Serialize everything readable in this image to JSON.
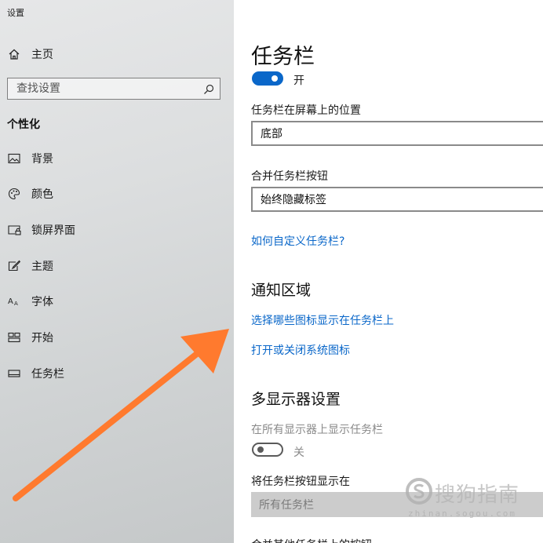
{
  "window": {
    "title": "设置"
  },
  "sidebar": {
    "home_label": "主页",
    "search_placeholder": "查找设置",
    "section_title": "个性化",
    "items": [
      {
        "label": "背景",
        "icon": "picture-icon"
      },
      {
        "label": "颜色",
        "icon": "palette-icon"
      },
      {
        "label": "锁屏界面",
        "icon": "lock-screen-icon"
      },
      {
        "label": "主题",
        "icon": "theme-icon"
      },
      {
        "label": "字体",
        "icon": "font-icon"
      },
      {
        "label": "开始",
        "icon": "start-icon"
      },
      {
        "label": "任务栏",
        "icon": "taskbar-icon"
      }
    ]
  },
  "main": {
    "title": "任务栏",
    "lock_toggle": {
      "state": "on",
      "label": "开"
    },
    "position": {
      "label": "任务栏在屏幕上的位置",
      "value": "底部"
    },
    "combine": {
      "label": "合并任务栏按钮",
      "value": "始终隐藏标签"
    },
    "customize_link": "如何自定义任务栏?",
    "notification": {
      "heading": "通知区域",
      "link_icons": "选择哪些图标显示在任务栏上",
      "link_system": "打开或关闭系统图标"
    },
    "multi_display": {
      "heading": "多显示器设置",
      "show_all_label": "在所有显示器上显示任务栏",
      "show_all_toggle": {
        "state": "off",
        "label": "关"
      },
      "buttons_label": "将任务栏按钮显示在",
      "buttons_value": "所有任务栏"
    },
    "partial_next": "合并其他任务栏上的按钮"
  },
  "overlay": {
    "arrow_color": "#ff7a2e",
    "watermark_text": "搜狗指南",
    "watermark_url": "zhinan.sogou.com"
  },
  "colors": {
    "accent": "#0a67c9",
    "sidebar_bg": "#d6d8d9",
    "disabled_field": "#cccccc"
  }
}
